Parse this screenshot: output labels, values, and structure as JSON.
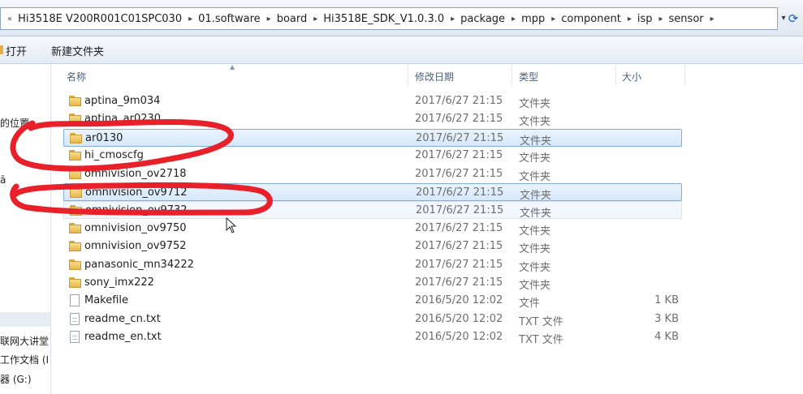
{
  "address": {
    "crumbs": [
      "Hi3518E V200R001C01SPC030",
      "01.software",
      "board",
      "Hi3518E_SDK_V1.0.3.0",
      "package",
      "mpp",
      "component",
      "isp",
      "sensor"
    ],
    "refresh_icon": "refresh-icon"
  },
  "toolbar": {
    "open_label": "打开",
    "new_folder_label": "新建文件夹"
  },
  "nav": {
    "items": [
      "的位置",
      "ā",
      "联网大讲堂",
      "工作文档 (I",
      "器 (G:)"
    ]
  },
  "columns": {
    "name": "名称",
    "date": "修改日期",
    "type": "类型",
    "size": "大小"
  },
  "files": [
    {
      "name": "aptina_9m034",
      "date": "2017/6/27 21:15",
      "type": "文件夹",
      "size": "",
      "kind": "folder"
    },
    {
      "name": "aptina_ar0230",
      "date": "2017/6/27 21:15",
      "type": "文件夹",
      "size": "",
      "kind": "folder"
    },
    {
      "name": "ar0130",
      "date": "2017/6/27 21:15",
      "type": "文件夹",
      "size": "",
      "kind": "folder"
    },
    {
      "name": "hi_cmoscfg",
      "date": "2017/6/27 21:15",
      "type": "文件夹",
      "size": "",
      "kind": "folder"
    },
    {
      "name": "omnivision_ov2718",
      "date": "2017/6/27 21:15",
      "type": "文件夹",
      "size": "",
      "kind": "folder"
    },
    {
      "name": "omnivision_ov9712",
      "date": "2017/6/27 21:15",
      "type": "文件夹",
      "size": "",
      "kind": "folder"
    },
    {
      "name": "omnivision_ov9732",
      "date": "2017/6/27 21:15",
      "type": "文件夹",
      "size": "",
      "kind": "folder"
    },
    {
      "name": "omnivision_ov9750",
      "date": "2017/6/27 21:15",
      "type": "文件夹",
      "size": "",
      "kind": "folder"
    },
    {
      "name": "omnivision_ov9752",
      "date": "2017/6/27 21:15",
      "type": "文件夹",
      "size": "",
      "kind": "folder"
    },
    {
      "name": "panasonic_mn34222",
      "date": "2017/6/27 21:15",
      "type": "文件夹",
      "size": "",
      "kind": "folder"
    },
    {
      "name": "sony_imx222",
      "date": "2017/6/27 21:15",
      "type": "文件夹",
      "size": "",
      "kind": "folder"
    },
    {
      "name": "Makefile",
      "date": "2016/5/20 12:02",
      "type": "文件",
      "size": "1 KB",
      "kind": "file"
    },
    {
      "name": "readme_cn.txt",
      "date": "2016/5/20 12:02",
      "type": "TXT 文件",
      "size": "3 KB",
      "kind": "txt"
    },
    {
      "name": "readme_en.txt",
      "date": "2016/5/20 12:02",
      "type": "TXT 文件",
      "size": "4 KB",
      "kind": "txt"
    }
  ],
  "selection": {
    "selected_rows": [
      "ar0130",
      "omnivision_ov9712"
    ],
    "hover_row": "omnivision_ov9732"
  },
  "annotation_color": "#e8202a"
}
